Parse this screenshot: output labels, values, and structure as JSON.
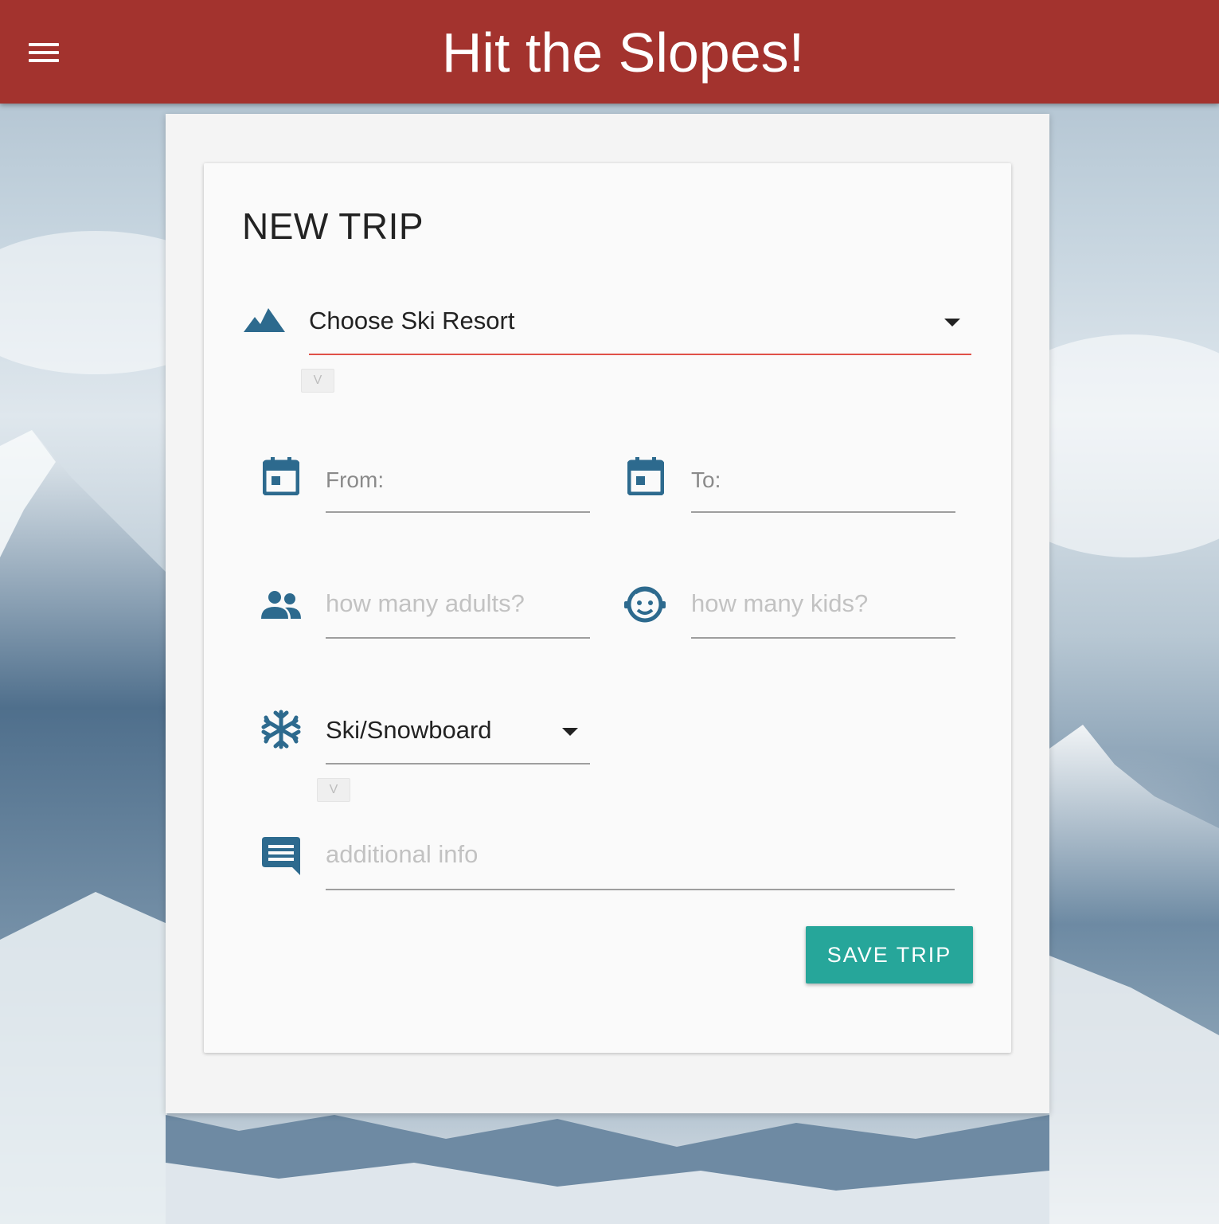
{
  "app": {
    "title": "Hit the Slopes!",
    "bar_color": "#a3332e"
  },
  "form": {
    "title": "NEW TRIP",
    "resort": {
      "icon": "terrain-icon",
      "selected": "Choose Ski Resort",
      "chip": "V"
    },
    "from": {
      "icon": "calendar-icon",
      "label": "From:",
      "value": ""
    },
    "to": {
      "icon": "calendar-icon",
      "label": "To:",
      "value": ""
    },
    "adults": {
      "icon": "people-icon",
      "placeholder": "how many adults?"
    },
    "kids": {
      "icon": "child-face-icon",
      "placeholder": "how many kids?"
    },
    "activity": {
      "icon": "snowflake-icon",
      "selected": "Ski/Snowboard",
      "chip": "V"
    },
    "info": {
      "icon": "comment-icon",
      "placeholder": "additional info"
    },
    "save_label": "SAVE TRIP"
  },
  "colors": {
    "icon": "#2d6a8e",
    "accent_underline": "#e05047",
    "button": "#26a69a"
  }
}
